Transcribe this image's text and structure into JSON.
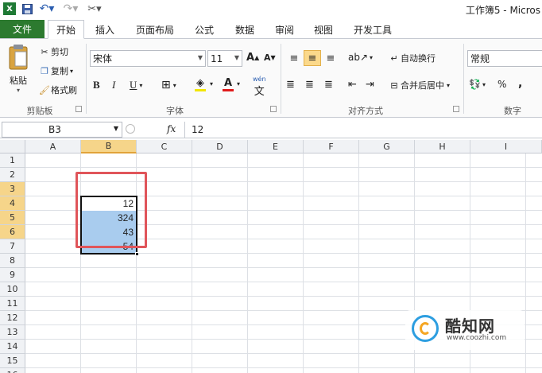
{
  "window": {
    "title": "工作簿5 - Micros"
  },
  "quick_access": {
    "icons": [
      "excel-icon",
      "save-icon",
      "undo-icon",
      "redo-icon",
      "customize-icon"
    ]
  },
  "ribbon_tabs": {
    "file": "文件",
    "items": [
      "开始",
      "插入",
      "页面布局",
      "公式",
      "数据",
      "审阅",
      "视图",
      "开发工具"
    ],
    "active": "开始"
  },
  "clipboard": {
    "paste": "粘贴",
    "cut": "剪切",
    "copy": "复制",
    "format_painter": "格式刷",
    "group_label": "剪贴板"
  },
  "font": {
    "font_name": "宋体",
    "font_size": "11",
    "grow": "A",
    "shrink": "A",
    "bold": "B",
    "italic": "I",
    "underline": "U",
    "wen": "wén",
    "group_label": "字体"
  },
  "alignment": {
    "wrap_text": "自动换行",
    "merge_center": "合并后居中",
    "group_label": "对齐方式"
  },
  "number": {
    "format": "常规",
    "percent": "%",
    "comma": ",",
    "group_label": "数字"
  },
  "formula_bar": {
    "name_box": "B3",
    "fx": "fx",
    "value": "12"
  },
  "grid": {
    "columns": [
      "A",
      "B",
      "C",
      "D",
      "E",
      "F",
      "G",
      "H",
      "I"
    ],
    "rows": [
      "1",
      "2",
      "3",
      "4",
      "5",
      "6",
      "7",
      "8",
      "9",
      "10",
      "11",
      "12",
      "13",
      "14",
      "15",
      "16"
    ],
    "cells": {
      "B3": "12",
      "B4": "324",
      "B5": "43",
      "B6": "54"
    },
    "selected_cell": "B3",
    "selected_range": "B3:B6"
  },
  "watermark": {
    "name": "酷知网",
    "url": "www.coozhi.com"
  }
}
